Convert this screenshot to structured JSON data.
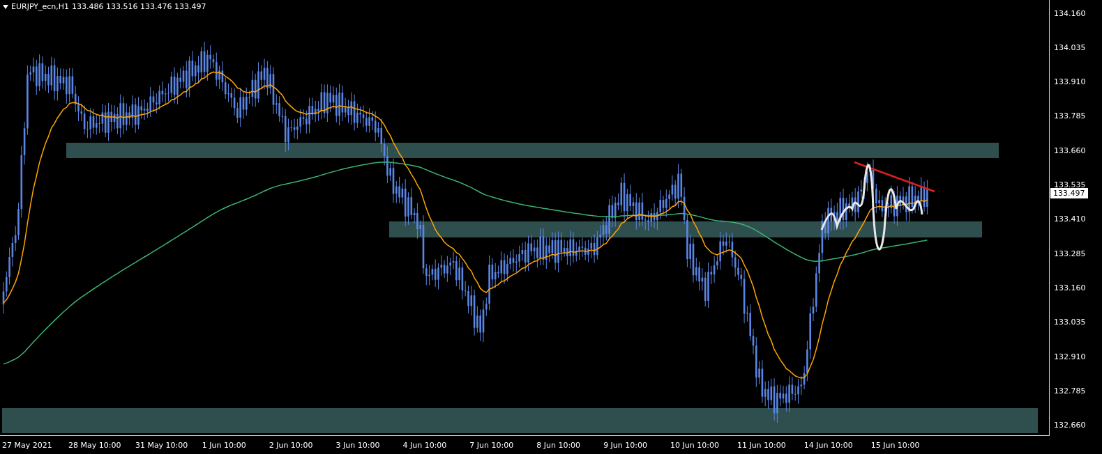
{
  "header": {
    "symbol": "EURJPY_ecn,H1",
    "ohlc": "133.486 133.516 133.476 133.497"
  },
  "price_axis": {
    "ticks": [
      "134.160",
      "134.035",
      "133.910",
      "133.785",
      "133.660",
      "133.535",
      "133.410",
      "133.285",
      "133.160",
      "133.035",
      "132.910",
      "132.785",
      "132.660"
    ],
    "current_price": "133.497"
  },
  "time_axis": {
    "labels": [
      "27 May 2021",
      "28 May 10:00",
      "31 May 10:00",
      "1 Jun 10:00",
      "2 Jun 10:00",
      "3 Jun 10:00",
      "4 Jun 10:00",
      "7 Jun 10:00",
      "8 Jun 10:00",
      "9 Jun 10:00",
      "10 Jun 10:00",
      "11 Jun 10:00",
      "14 Jun 10:00",
      "15 Jun 10:00"
    ]
  }
}
